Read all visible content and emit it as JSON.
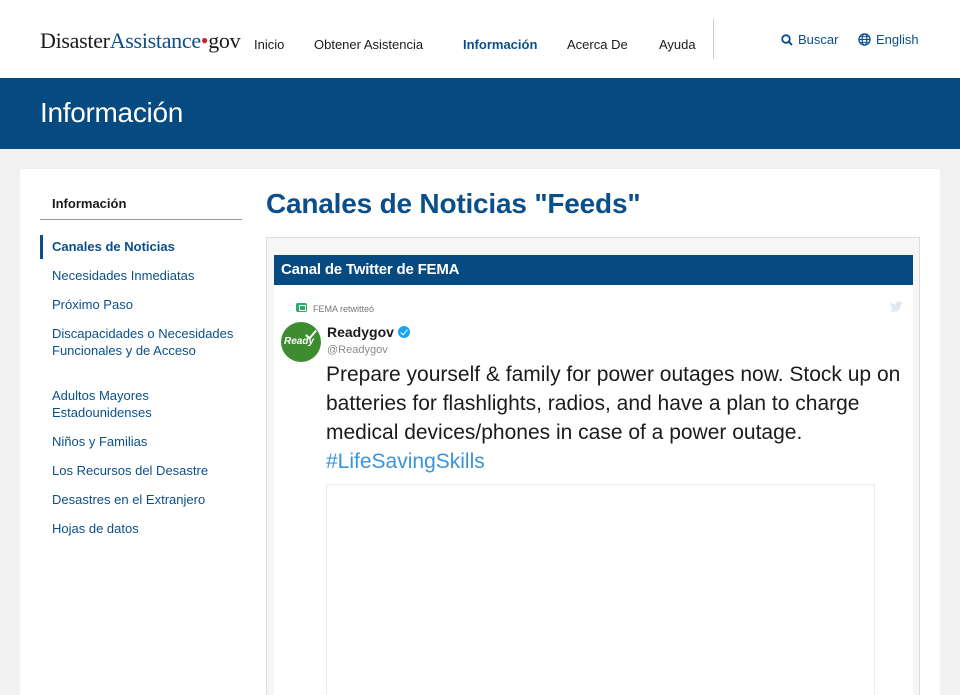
{
  "header": {
    "logo_part1": "Disaster",
    "logo_part2": "Assistance",
    "logo_dot": "•",
    "logo_tld": "gov",
    "nav": [
      "Inicio",
      "Obtener Asistencia",
      "Información",
      "Acerca De",
      "Ayuda"
    ],
    "active_nav": "Información",
    "search_label": "Buscar",
    "language_label": "English",
    "search_icon": "search-icon",
    "language_icon": "globe-icon"
  },
  "banner": {
    "title": "Información"
  },
  "sidebar": {
    "title": "Información",
    "items": [
      "Canales de Noticias",
      "Necesidades Inmediatas",
      "Próximo Paso",
      "Discapacidades o Necesidades Funcionales y de Acceso",
      "Adultos Mayores Estadounidenses",
      "Niños y Familias",
      "Los Recursos del Desastre",
      "Desastres en el Extranjero",
      "Hojas de datos"
    ]
  },
  "main": {
    "title": "Canales de Noticias \"Feeds\"",
    "feed_title": "Canal de Twitter de FEMA",
    "tweet": {
      "retweet_label": "FEMA retwitteó",
      "avatar_text": "Ready",
      "name": "Readygov",
      "handle": "@Readygov",
      "text": "Prepare yourself & family for power outages now. Stock up on batteries for flashlights, radios, and have a plan to charge medical devices/phones in case of a power outage.",
      "hashtag": "#LifeSavingSkills"
    }
  },
  "colors": {
    "brand_blue": "#054a80",
    "link_blue": "#0b4f8a",
    "hashtag_blue": "#3b94d9",
    "logo_red": "#c0272d"
  }
}
